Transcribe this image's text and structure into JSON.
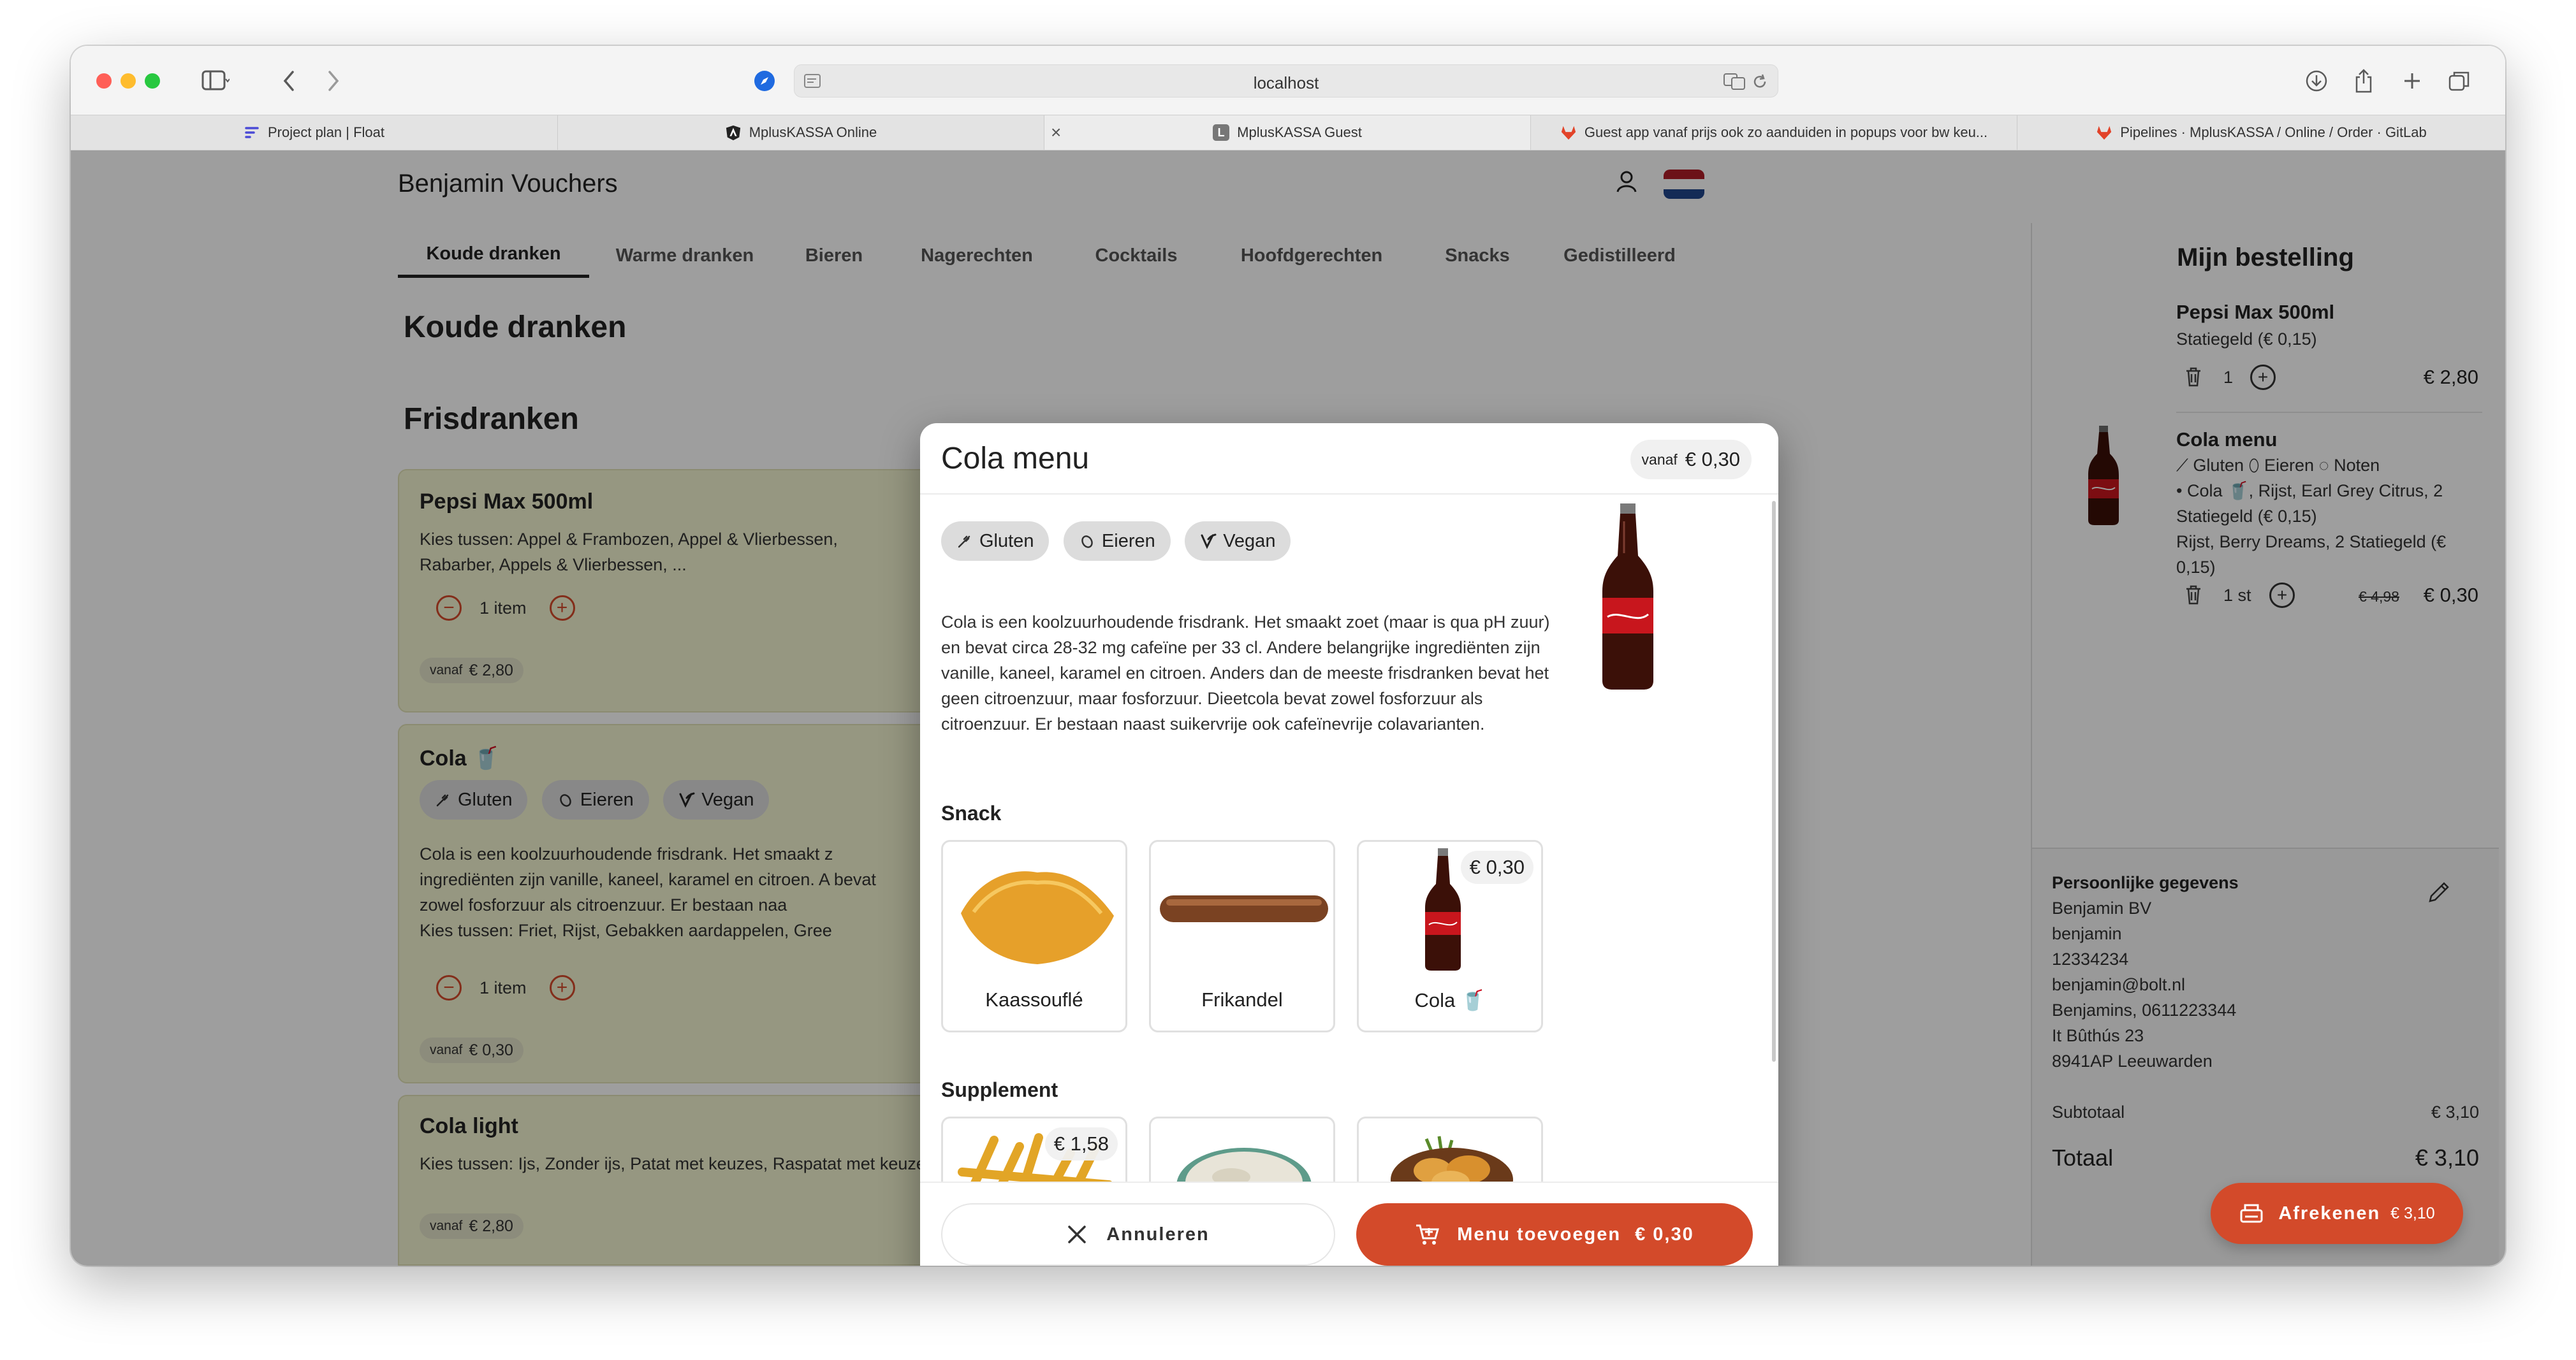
{
  "browser": {
    "url": "localhost",
    "tabs": [
      {
        "label": "Project plan | Float"
      },
      {
        "label": "MplusKASSA Online"
      },
      {
        "label": "MplusKASSA Guest"
      },
      {
        "label": "Guest app vanaf prijs ook zo aanduiden in popups voor bw keu..."
      },
      {
        "label": "Pipelines · MplusKASSA / Online / Order · GitLab"
      }
    ],
    "tab_close": "×"
  },
  "header": {
    "brand": "Benjamin Vouchers",
    "user_icon": "user-icon",
    "flag_colors": [
      "#ae1c28",
      "#ffffff",
      "#21468b"
    ]
  },
  "categories": [
    {
      "label": "Koude dranken"
    },
    {
      "label": "Warme dranken"
    },
    {
      "label": "Bieren"
    },
    {
      "label": "Nagerechten"
    },
    {
      "label": "Cocktails"
    },
    {
      "label": "Hoofdgerechten"
    },
    {
      "label": "Snacks"
    },
    {
      "label": "Gedistilleerd"
    }
  ],
  "page": {
    "title": "Koude dranken",
    "subtitle": "Frisdranken"
  },
  "products": [
    {
      "name": "Pepsi Max 500ml",
      "desc": "Kies tussen: Appel & Frambozen, Appel & Vlierbessen, Rabarber, Appels & Vlierbessen, ...",
      "qty": "1 item",
      "from": "vanaf",
      "price": "€ 2,80"
    },
    {
      "name": "Cola 🥤",
      "chips": [
        "Gluten",
        "Eieren",
        "Vegan"
      ],
      "desc": "Cola is een koolzuurhoudende frisdrank. Het smaakt z ingrediënten zijn vanille, kaneel, karamel en citroen. A bevat zowel fosforzuur als citroenzuur. Er bestaan naa",
      "desc2": "Kies tussen: Friet, Rijst, Gebakken aardappelen, Gree",
      "qty": "1 item",
      "from": "vanaf",
      "price": "€ 0,30"
    },
    {
      "name": "Cola light",
      "desc": "Kies tussen: Ijs, Zonder ijs, Patat met keuzes, Raspatat met keuzes",
      "from": "vanaf",
      "price": "€ 2,80"
    }
  ],
  "order": {
    "title": "Mijn bestelling",
    "items": [
      {
        "name": "Pepsi Max 500ml",
        "sub": "Statiegeld (€ 0,15)",
        "qty": "1",
        "price": "€ 2,80"
      },
      {
        "name": "Cola menu",
        "allergens": [
          "Gluten",
          "Eieren",
          "Noten"
        ],
        "line1": "•  Cola 🥤, Rijst, Earl Grey Citrus, 2 Statiegeld (€ 0,15)",
        "line2": "Rijst, Berry Dreams, 2 Statiegeld (€ 0,15)",
        "qty": "1 st",
        "old_price": "€ 4,98",
        "price": "€ 0,30"
      }
    ],
    "personal": {
      "title": "Persoonlijke gegevens",
      "lines": [
        "Benjamin BV",
        "benjamin",
        "12334234",
        "benjamin@bolt.nl",
        "Benjamins, 0611223344",
        "It Bûthús 23",
        "8941AP Leeuwarden"
      ]
    },
    "subtotal_label": "Subtotaal",
    "subtotal": "€ 3,10",
    "total_label": "Totaal",
    "total": "€ 3,10",
    "checkout_label": "Afrekenen",
    "checkout_price": "€ 3,10"
  },
  "modal": {
    "title": "Cola menu",
    "from": "vanaf",
    "price": "€ 0,30",
    "chips": [
      "Gluten",
      "Eieren",
      "Vegan"
    ],
    "description": "Cola is een koolzuurhoudende frisdrank. Het smaakt zoet (maar is qua pH zuur) en bevat circa 28-32 mg cafeïne per 33 cl. Andere belangrijke ingrediënten zijn vanille, kaneel, karamel en citroen. Anders dan de meeste frisdranken bevat het geen citroenzuur, maar fosforzuur. Dieetcola bevat zowel fosforzuur als citroenzuur. Er bestaan naast suikervrije ook cafeïnevrije colavarianten.",
    "sections": [
      {
        "title": "Snack",
        "options": [
          {
            "name": "Kaassouflé",
            "price": ""
          },
          {
            "name": "Frikandel",
            "price": ""
          },
          {
            "name": "Cola 🥤",
            "price": "€ 0,30"
          }
        ]
      },
      {
        "title": "Supplement",
        "options": [
          {
            "name": "",
            "price": "€ 1,58"
          },
          {
            "name": "",
            "price": ""
          },
          {
            "name": "",
            "price": ""
          }
        ]
      }
    ],
    "cancel_label": "Annuleren",
    "add_label": "Menu toevoegen",
    "add_price": "€ 0,30"
  },
  "colors": {
    "accent": "#d34a2a",
    "card_bg": "#f3f4d0",
    "overlay": "rgba(0,0,0,0.38)"
  }
}
